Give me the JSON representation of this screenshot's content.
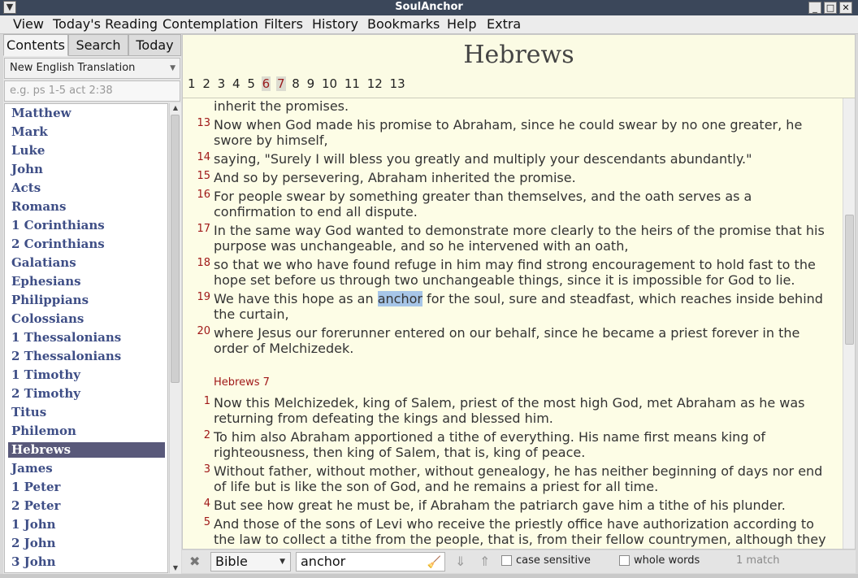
{
  "window": {
    "title": "SoulAnchor"
  },
  "menu": [
    "View",
    "Today's Reading",
    "Contemplation",
    "Filters",
    "History",
    "Bookmarks",
    "Help",
    "Extra"
  ],
  "tabs": {
    "contents": "Contents",
    "search": "Search",
    "today": "Today"
  },
  "translation": "New English Translation",
  "ref_placeholder": "e.g. ps 1-5 act 2:38",
  "books": [
    "Matthew",
    "Mark",
    "Luke",
    "John",
    "Acts",
    "Romans",
    "1 Corinthians",
    "2 Corinthians",
    "Galatians",
    "Ephesians",
    "Philippians",
    "Colossians",
    "1 Thessalonians",
    "2 Thessalonians",
    "1 Timothy",
    "2 Timothy",
    "Titus",
    "Philemon",
    "Hebrews",
    "James",
    "1 Peter",
    "2 Peter",
    "1 John",
    "2 John",
    "3 John"
  ],
  "selected_book": "Hebrews",
  "reader": {
    "book_title": "Hebrews",
    "chapters": [
      "1",
      "2",
      "3",
      "4",
      "5",
      "6",
      "7",
      "8",
      "9",
      "10",
      "11",
      "12",
      "13"
    ],
    "highlighted_chapters": [
      "6",
      "7"
    ],
    "cont_text": "inherit the promises.",
    "chapter6_verses": [
      {
        "num": "13",
        "text": "Now when God made his promise to Abraham, since he could swear by no one greater, he swore by himself,"
      },
      {
        "num": "14",
        "text": "saying, \"Surely I will bless you greatly and multiply your descendants abundantly.\""
      },
      {
        "num": "15",
        "text": "And so by persevering, Abraham inherited the promise."
      },
      {
        "num": "16",
        "text": "For people swear by something greater than themselves, and the oath serves as a confirmation to end all dispute."
      },
      {
        "num": "17",
        "text": "In the same way God wanted to demonstrate more clearly to the heirs of the promise that his purpose was unchangeable, and so he intervened with an oath,"
      },
      {
        "num": "18",
        "text": "so that we who have found refuge in him may find strong encouragement to hold fast to the hope set before us through two unchangeable things, since it is impossible for God to lie."
      },
      {
        "num": "19",
        "text_before": "We have this hope as an ",
        "highlight": "anchor",
        "text_after": " for the soul, sure and steadfast, which reaches inside behind the curtain,"
      },
      {
        "num": "20",
        "text": "where Jesus our forerunner entered on our behalf, since he became a priest forever in the order of Melchizedek."
      }
    ],
    "chapter7_heading": "Hebrews 7",
    "chapter7_verses": [
      {
        "num": "1",
        "text": "Now this Melchizedek, king of Salem, priest of the most high God, met Abraham as he was returning from defeating the kings and blessed him."
      },
      {
        "num": "2",
        "text": "To him also Abraham apportioned a tithe of everything. His name first means king of righteousness, then king of Salem, that is, king of peace."
      },
      {
        "num": "3",
        "text": "Without father, without mother, without genealogy, he has neither beginning of days nor end of life but is like the son of God, and he remains a priest for all time."
      },
      {
        "num": "4",
        "text": "But see how great he must be, if Abraham the patriarch gave him a tithe of his plunder."
      },
      {
        "num": "5",
        "text": "And those of the sons of Levi who receive the priestly office have authorization according to the law to collect a tithe from the people, that is, from their fellow countrymen, although they"
      }
    ]
  },
  "findbar": {
    "scope": "Bible",
    "query": "anchor",
    "case_sensitive_label": "case sensitive",
    "whole_words_label": "whole words",
    "match_count": "1 match"
  },
  "icons": {
    "window_menu": "menu-arrow-icon",
    "minimize": "minimize-icon",
    "maximize": "maximize-icon",
    "close": "close-icon",
    "clear": "broom-icon",
    "next": "down-arrow-icon",
    "prev": "up-arrow-icon"
  }
}
